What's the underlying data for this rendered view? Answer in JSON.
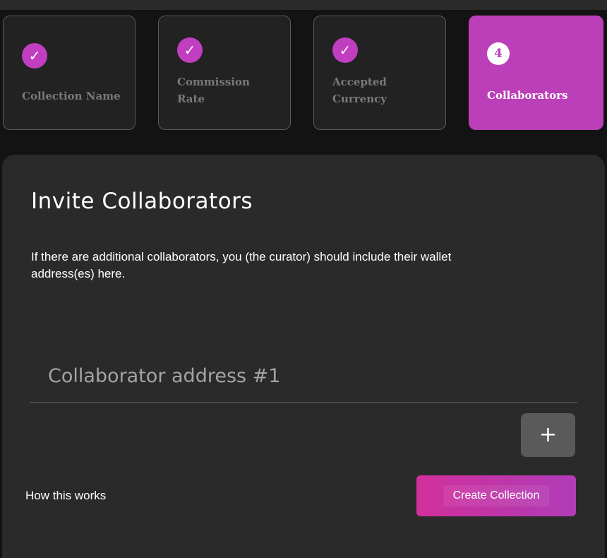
{
  "steps": [
    {
      "label": "Collection Name",
      "status": "complete",
      "badge": "✓"
    },
    {
      "label": "Commission Rate",
      "status": "complete",
      "badge": "✓"
    },
    {
      "label": "Accepted Currency",
      "status": "complete",
      "badge": "✓"
    },
    {
      "label": "Collaborators",
      "status": "active",
      "badge": "4"
    }
  ],
  "panel": {
    "title": "Invite Collaborators",
    "description": "If there are additional collaborators, you (the curator) should include their wallet address(es) here.",
    "address_input": {
      "placeholder": "Collaborator address #1",
      "value": ""
    },
    "add_button_label": "+",
    "how_link": "How this works",
    "create_button_label": "Create Collection"
  },
  "colors": {
    "accent": "#bb3fb8",
    "background": "#131313",
    "panel": "#2a2a2b"
  },
  "icons": {
    "completed_step": "check-icon",
    "add": "plus-icon"
  }
}
